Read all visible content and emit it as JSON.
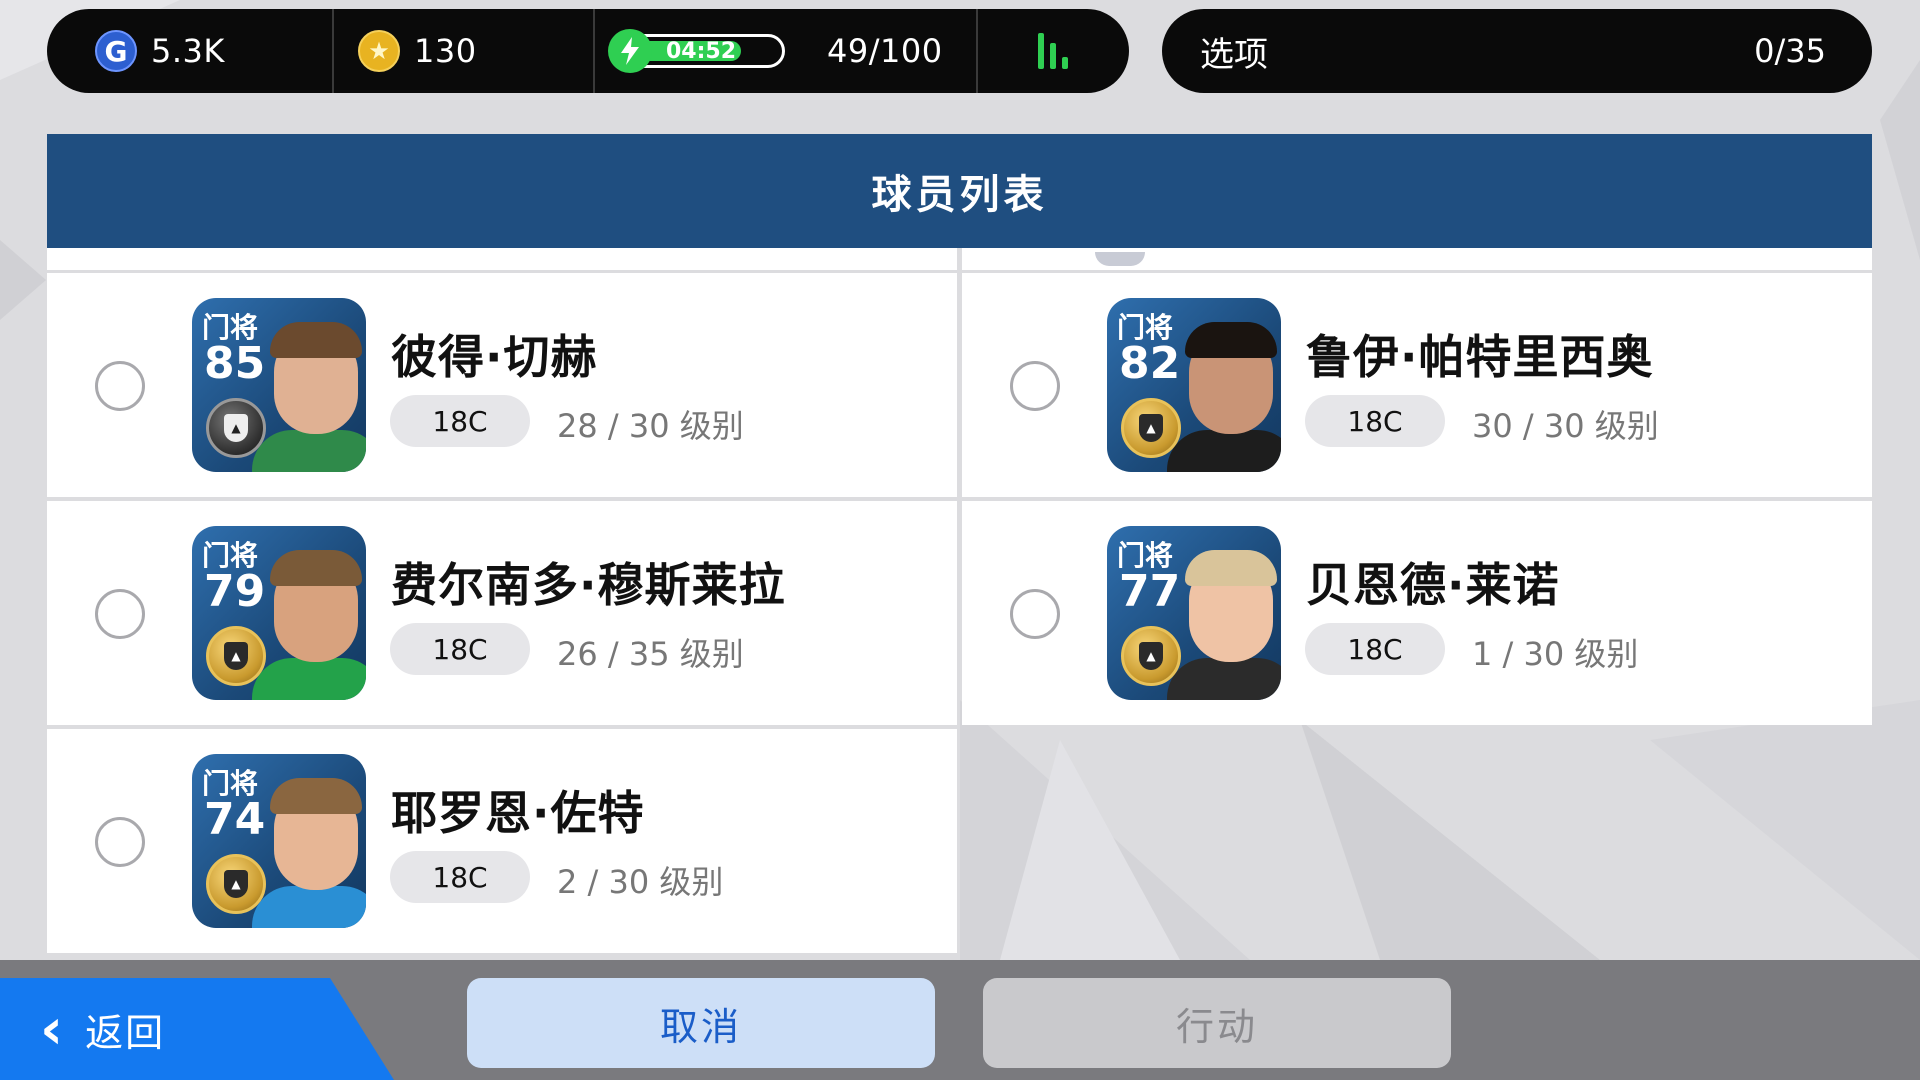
{
  "status": {
    "gp_icon": "G",
    "gp": "5.3K",
    "coin_icon": "★",
    "coins": "130",
    "stamina_time": "04:52",
    "stamina_progress": 0.78,
    "stamina_count": "49/100",
    "colors": {
      "accent_green": "#2fcf52",
      "gp_blue": "#2d5fd0",
      "coin_gold": "#e8b321"
    }
  },
  "options": {
    "label": "选项",
    "count": "0/35"
  },
  "header": {
    "title": "球员列表"
  },
  "players": [
    {
      "position": "门将",
      "rating": "85",
      "name": "彼得·切赫",
      "tag": "18C",
      "level": "28 / 30 级别",
      "badge": "black"
    },
    {
      "position": "门将",
      "rating": "82",
      "name": "鲁伊·帕特里西奥",
      "tag": "18C",
      "level": "30 / 30 级别",
      "badge": "gold"
    },
    {
      "position": "门将",
      "rating": "79",
      "name": "费尔南多·穆斯莱拉",
      "tag": "18C",
      "level": "26 / 35 级别",
      "badge": "gold"
    },
    {
      "position": "门将",
      "rating": "77",
      "name": "贝恩德·莱诺",
      "tag": "18C",
      "level": "1 / 30 级别",
      "badge": "gold"
    },
    {
      "position": "门将",
      "rating": "74",
      "name": "耶罗恩·佐特",
      "tag": "18C",
      "level": "2 / 30 级别",
      "badge": "gold"
    }
  ],
  "footer": {
    "back_label": "返回",
    "back_chevron": "‹",
    "cancel_label": "取消",
    "action_label": "行动",
    "colors": {
      "back_blue": "#1479f0",
      "header_blue": "#1f4e80"
    }
  }
}
